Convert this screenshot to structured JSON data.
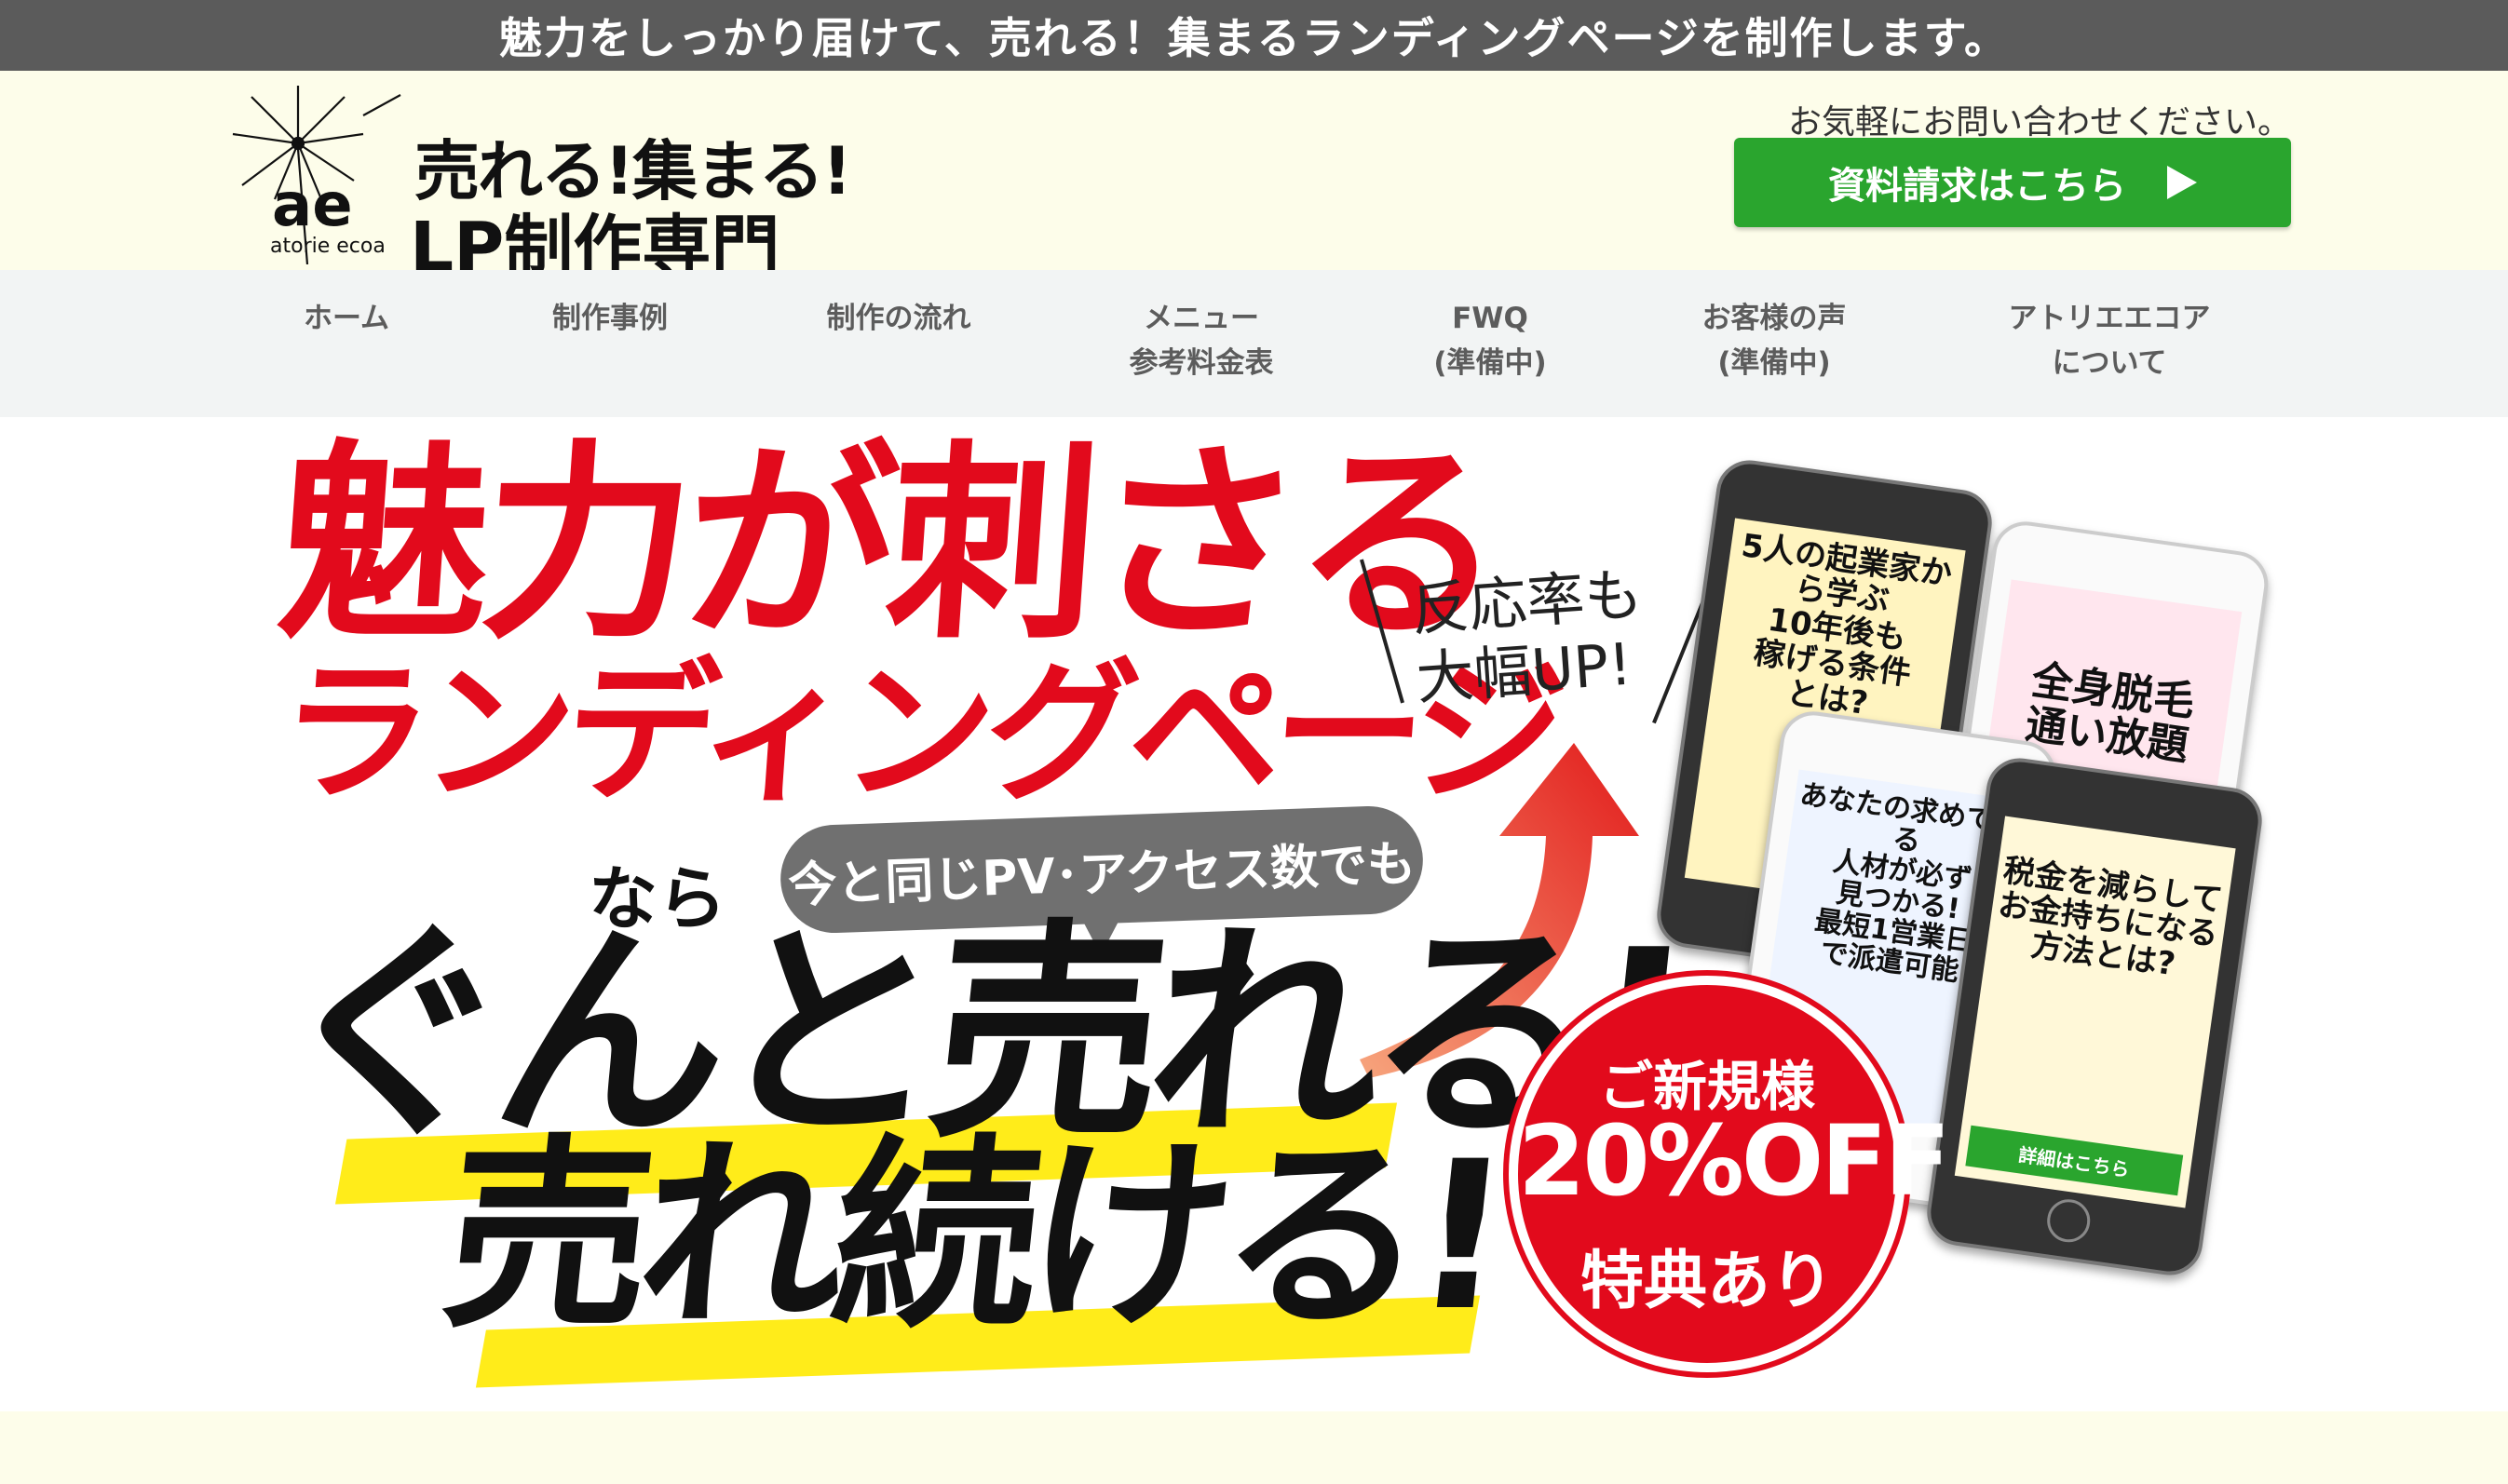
{
  "topbar": {
    "text": "魅力をしっかり届けて、売れる！集まるランディングページを制作します。"
  },
  "header": {
    "logo_title_line1": "売れる!集まる!",
    "logo_title_line2": "LP制作専門",
    "logo_mark": "ae",
    "logo_sub": "atorie ecoa",
    "contact_note": "お気軽にお問い合わせください。",
    "cta_label": "資料請求はこちら"
  },
  "nav": {
    "items": [
      {
        "label": "ホーム"
      },
      {
        "label": "制作事例"
      },
      {
        "label": "制作の流れ"
      },
      {
        "label": "メニュー\n参考料金表"
      },
      {
        "label": "FWQ\n(準備中)"
      },
      {
        "label": "お客様の声\n(準備中)"
      },
      {
        "label": "アトリエエコア\nについて"
      }
    ]
  },
  "hero": {
    "headline_red_1": "魅力が刺さる",
    "headline_red_2": "ランディングページ",
    "bubble": "今と同じPV･アクセス数でも",
    "nara": "なら",
    "headline_black_1": "ぐんと売れる!",
    "headline_black_2": "売れ続ける!",
    "handwritten": "反応率も\n大幅UP!",
    "badge": {
      "line1": "ご新規様",
      "line2": "20%OFF",
      "line3": "特典あり"
    },
    "phones": [
      {
        "text": "5人の起業家から学ぶ\n10年後も\n稼げる条件\nとは?"
      },
      {
        "text": "全身脱毛\n通い放題"
      },
      {
        "text": "あなたの求めている\n人材が必ず\n見つかる!\n最短1営業日\nで派遣可能"
      },
      {
        "text": "税金を減らして\nお金持ちになる\n方法とは?",
        "button": "詳細はこちら"
      }
    ]
  },
  "colors": {
    "accent_red": "#e20a1c",
    "cta_green": "#2aa52e",
    "topbar_gray": "#5b5b5b",
    "highlight_yellow": "#ffec1a"
  }
}
